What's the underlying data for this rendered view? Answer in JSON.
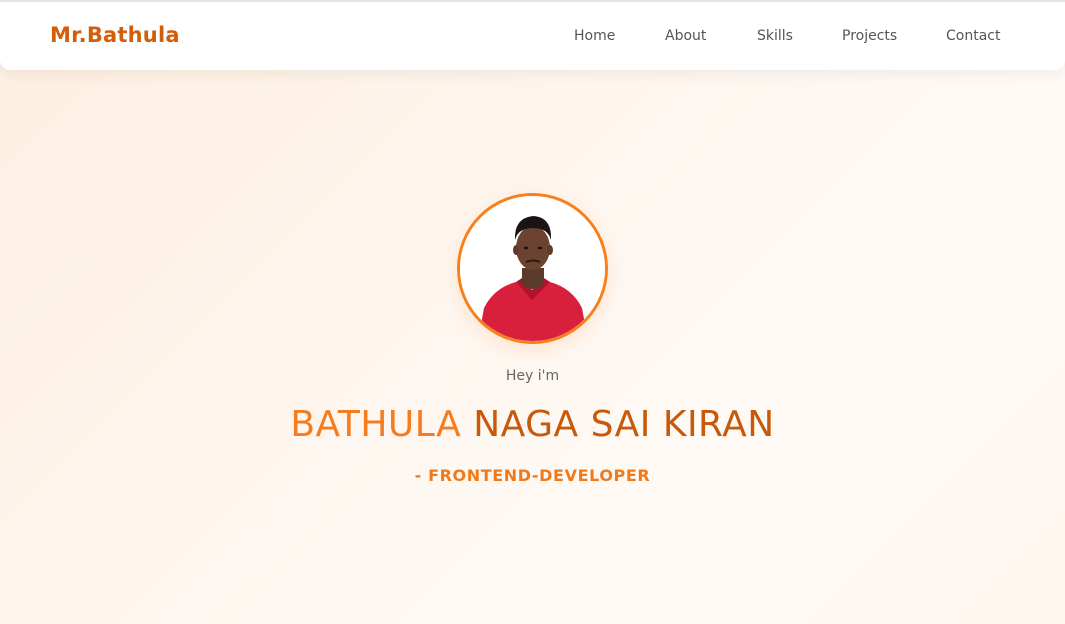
{
  "navbar": {
    "brand": "Mr.Bathula",
    "links": [
      {
        "label": "Home"
      },
      {
        "label": "About"
      },
      {
        "label": "Skills"
      },
      {
        "label": "Projects"
      },
      {
        "label": "Contact"
      }
    ]
  },
  "hero": {
    "greeting": "Hey i'm",
    "name_first": "BATHULA",
    "name_rest": "NAGA SAI KIRAN",
    "role": "- FRONTEND-DEVELOPER"
  },
  "colors": {
    "brand": "#d25d0a",
    "accent": "#f77f1c",
    "name_first": "#f57c1f",
    "name_rest": "#c7590b",
    "shirt": "#d81f3c"
  }
}
